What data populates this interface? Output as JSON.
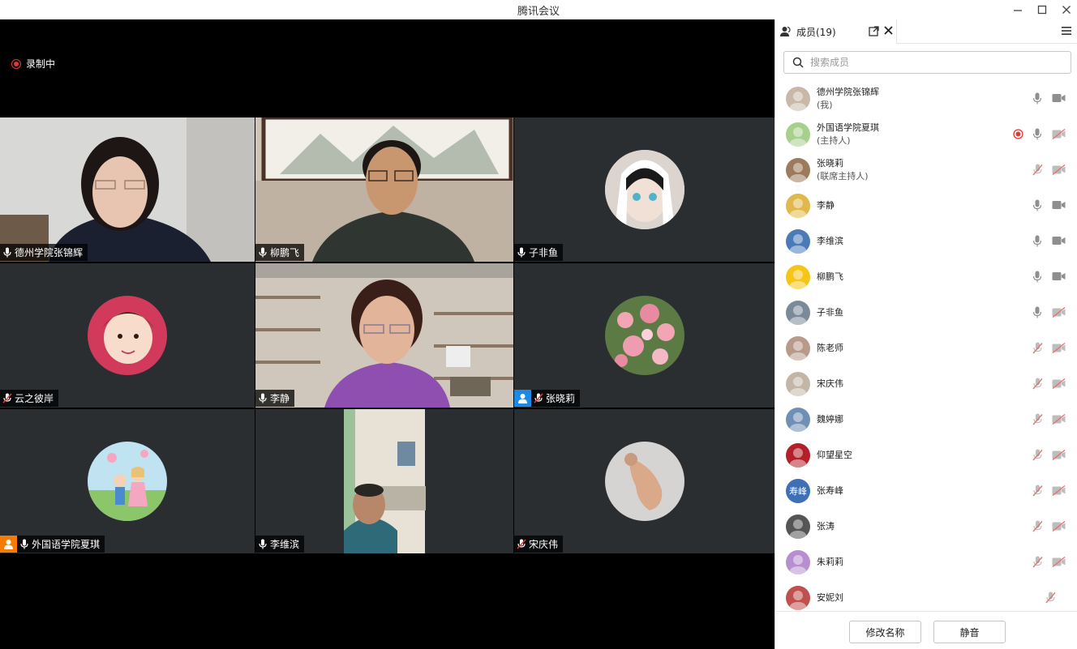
{
  "window": {
    "title": "腾讯会议"
  },
  "recording": {
    "label": "录制中"
  },
  "tiles": [
    {
      "name": "德州学院张锦辉",
      "mic": "on"
    },
    {
      "name": "柳鹏飞",
      "mic": "on"
    },
    {
      "name": "子非鱼",
      "mic": "on"
    },
    {
      "name": "云之彼岸",
      "mic": "muted"
    },
    {
      "name": "李静",
      "mic": "on"
    },
    {
      "name": "张晓莉",
      "mic": "muted",
      "badge": "cohost"
    },
    {
      "name": "外国语学院夏琪",
      "mic": "on",
      "badge": "host"
    },
    {
      "name": "李维滨",
      "mic": "on"
    },
    {
      "name": "宋庆伟",
      "mic": "muted"
    }
  ],
  "panel": {
    "tab_label": "成员(19)",
    "search_placeholder": "搜索成员",
    "members": [
      {
        "name": "德州学院张锦辉",
        "role": "(我)",
        "mic": "on",
        "cam": "on",
        "avatar_color": "#c9b8a8"
      },
      {
        "name": "外国语学院夏琪",
        "role": "(主持人)",
        "mic": "on",
        "cam": "off",
        "rec": true,
        "avatar_color": "#a8d08d"
      },
      {
        "name": "张晓莉",
        "role": "(联席主持人)",
        "mic": "muted",
        "cam": "off",
        "avatar_color": "#9c7a5b"
      },
      {
        "name": "李静",
        "role": "",
        "mic": "on",
        "cam": "on",
        "avatar_color": "#e0b84c"
      },
      {
        "name": "李维滨",
        "role": "",
        "mic": "on",
        "cam": "on",
        "avatar_color": "#4a7ab8"
      },
      {
        "name": "柳鹏飞",
        "role": "",
        "mic": "on",
        "cam": "on",
        "avatar_color": "#f5c518"
      },
      {
        "name": "子非鱼",
        "role": "",
        "mic": "on",
        "cam": "off",
        "avatar_color": "#7a8a99"
      },
      {
        "name": "陈老师",
        "role": "",
        "mic": "muted",
        "cam": "off",
        "avatar_color": "#b89a8a"
      },
      {
        "name": "宋庆伟",
        "role": "",
        "mic": "muted",
        "cam": "off",
        "avatar_color": "#c2b6a6"
      },
      {
        "name": "魏婷娜",
        "role": "",
        "mic": "muted",
        "cam": "off",
        "avatar_color": "#6f8fb5"
      },
      {
        "name": "仰望星空",
        "role": "",
        "mic": "muted",
        "cam": "off",
        "avatar_color": "#b3202a"
      },
      {
        "name": "张寿峰",
        "role": "",
        "mic": "muted",
        "cam": "off",
        "avatar_color": "#3f6fb5",
        "initials": "寿峰"
      },
      {
        "name": "张涛",
        "role": "",
        "mic": "muted",
        "cam": "off",
        "avatar_color": "#555555"
      },
      {
        "name": "朱莉莉",
        "role": "",
        "mic": "muted",
        "cam": "off",
        "avatar_color": "#b78fd0"
      },
      {
        "name": "安妮刘",
        "role": "",
        "mic": "muted",
        "cam": "",
        "avatar_color": "#c0504d"
      }
    ],
    "rename_label": "修改名称",
    "mute_label": "静音"
  },
  "colors": {
    "accent_red": "#e53935",
    "host_badge": "#f57c00",
    "cohost_badge": "#1e88e5",
    "muted_red": "#e57373"
  }
}
